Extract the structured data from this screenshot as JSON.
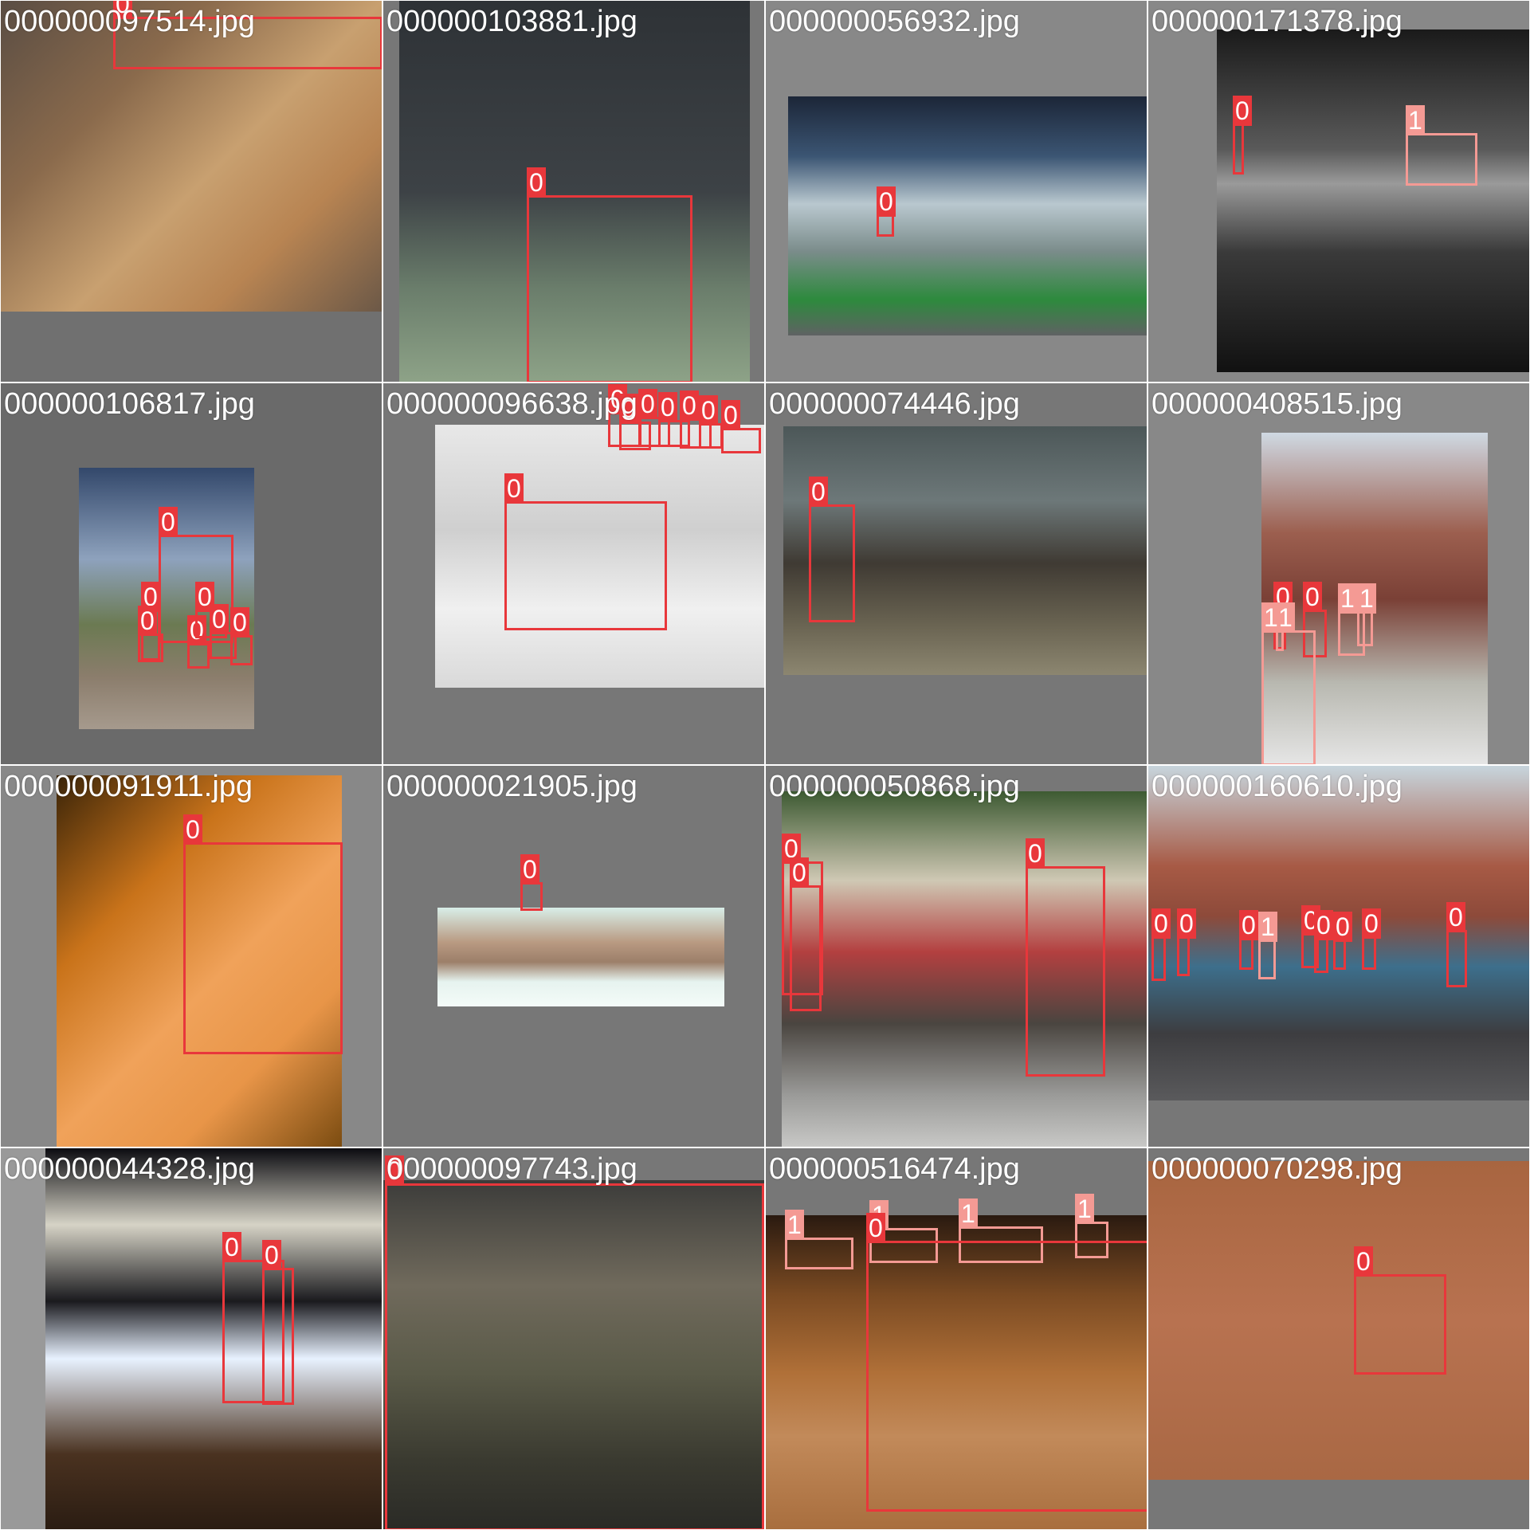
{
  "colors": {
    "class_0": "#e8373b",
    "class_1": "#f49a94",
    "padding": "#777777"
  },
  "tiles": [
    {
      "filename": "000000097514.jpg",
      "pad": "#707070",
      "photo": {
        "fill": "linear-gradient(135deg,#5a4d43 0%,#8a6a4c 30%,#c8a070 55%,#b88452 75%,#6b5847 100%)"
      },
      "boxes": [
        {
          "label": "0",
          "cls": 0
        }
      ]
    },
    {
      "filename": "000000103881.jpg",
      "pad": "#777777",
      "photo": {
        "fill": "linear-gradient(180deg,#2e3236 0%,#3d4246 50%,#6a7d6b 75%,#8ea388 100%)"
      },
      "boxes": [
        {
          "label": "0",
          "cls": 0
        }
      ]
    },
    {
      "filename": "000000056932.jpg",
      "pad": "#888888",
      "photo": {
        "fill": "linear-gradient(180deg,#1c2638 0%,#3b5573 25%,#b9c8cf 45%,#7a8c8a 65%,#2d8a3d 85%,#5f6263 100%)"
      },
      "boxes": [
        {
          "label": "0",
          "cls": 0
        }
      ]
    },
    {
      "filename": "000000171378.jpg",
      "pad": "#888888",
      "photo": {
        "fill": "linear-gradient(180deg,#1a1a1a 0%,#5a5a5a 35%,#9a9a9a 45%,#3a3a3a 65%,#111111 100%)"
      },
      "boxes": [
        {
          "label": "0",
          "cls": 0
        },
        {
          "label": "1",
          "cls": 1
        }
      ]
    },
    {
      "filename": "000000106817.jpg",
      "pad": "#6a6a6a",
      "photo": {
        "fill": "linear-gradient(180deg,#33486b 0%,#8ea2bd 35%,#6b7a52 60%,#8b7d6c 80%,#a69a8d 100%)"
      },
      "boxes": [
        {
          "label": "0",
          "cls": 0
        },
        {
          "label": "0",
          "cls": 0
        },
        {
          "label": "0",
          "cls": 0
        },
        {
          "label": "0",
          "cls": 0
        },
        {
          "label": "0",
          "cls": 0
        },
        {
          "label": "0",
          "cls": 0
        },
        {
          "label": "0",
          "cls": 0
        }
      ]
    },
    {
      "filename": "000000096638.jpg",
      "pad": "#777777",
      "photo": {
        "fill": "linear-gradient(180deg,#e8e8e8 0%,#cfcfcf 40%,#f0f0f0 70%,#d9d9d9 100%)"
      },
      "boxes": [
        {
          "label": "0",
          "cls": 0
        },
        {
          "label": "0",
          "cls": 0
        },
        {
          "label": "0",
          "cls": 0
        },
        {
          "label": "0",
          "cls": 0
        },
        {
          "label": "0",
          "cls": 0
        },
        {
          "label": "0",
          "cls": 0
        },
        {
          "label": "0",
          "cls": 0
        },
        {
          "label": "0",
          "cls": 0
        }
      ]
    },
    {
      "filename": "000000074446.jpg",
      "pad": "#777777",
      "photo": {
        "fill": "linear-gradient(180deg,#4c5758 0%,#6d7879 30%,#3f3a33 55%,#6a6452 80%,#8c8670 100%)"
      },
      "boxes": [
        {
          "label": "0",
          "cls": 0
        }
      ]
    },
    {
      "filename": "000000408515.jpg",
      "pad": "#888888",
      "photo": {
        "fill": "linear-gradient(180deg,#cfd9e3 0%,#9c5f4f 30%,#7a4036 50%,#b8b8b0 75%,#e6e6e6 100%)"
      },
      "boxes": [
        {
          "label": "0",
          "cls": 0
        },
        {
          "label": "0",
          "cls": 0
        },
        {
          "label": "1",
          "cls": 1
        },
        {
          "label": "1",
          "cls": 1
        },
        {
          "label": "1",
          "cls": 1
        },
        {
          "label": "1",
          "cls": 1
        }
      ]
    },
    {
      "filename": "000000091911.jpg",
      "pad": "#888888",
      "photo": {
        "fill": "linear-gradient(135deg,#3a2408 0%,#c9731a 30%,#f0a25a 55%,#e89548 75%,#7a4b10 100%)"
      },
      "boxes": [
        {
          "label": "0",
          "cls": 0
        }
      ]
    },
    {
      "filename": "000000021905.jpg",
      "pad": "#777777",
      "photo": {
        "fill": "linear-gradient(180deg,#d8eee8 0%,#b99a82 35%,#9c7f69 55%,#e6f3ef 75%,#f4fbf8 100%)"
      },
      "boxes": [
        {
          "label": "0",
          "cls": 0
        }
      ]
    },
    {
      "filename": "000000050868.jpg",
      "pad": "#777777",
      "photo": {
        "fill": "linear-gradient(180deg,#3d5a32 0%,#cfc8b4 25%,#b34040 45%,#4a4540 65%,#9a9a98 85%,#c9c9c7 100%)"
      },
      "boxes": [
        {
          "label": "0",
          "cls": 0
        },
        {
          "label": "0",
          "cls": 0
        },
        {
          "label": "0",
          "cls": 0
        }
      ]
    },
    {
      "filename": "000000160610.jpg",
      "pad": "#777777",
      "photo": {
        "fill": "linear-gradient(180deg,#c7d5dd 0%,#a75a45 30%,#8d4a3a 45%,#3d6f8c 60%,#3d3d40 80%,#5a5a5c 100%)"
      },
      "boxes": [
        {
          "label": "0",
          "cls": 0
        },
        {
          "label": "0",
          "cls": 0
        },
        {
          "label": "0",
          "cls": 0
        },
        {
          "label": "1",
          "cls": 1
        },
        {
          "label": "0",
          "cls": 0
        },
        {
          "label": "0",
          "cls": 0
        },
        {
          "label": "0",
          "cls": 0
        },
        {
          "label": "0",
          "cls": 0
        },
        {
          "label": "0",
          "cls": 0
        }
      ]
    },
    {
      "filename": "000000044328.jpg",
      "pad": "#999999",
      "photo": {
        "fill": "linear-gradient(180deg,#0b0b10 0%,#d6d3c6 20%,#1a1a1e 40%,#e8f2ff 55%,#4a3220 80%,#2a1c12 100%)"
      },
      "boxes": [
        {
          "label": "0",
          "cls": 0
        },
        {
          "label": "0",
          "cls": 0
        }
      ]
    },
    {
      "filename": "000000097743.jpg",
      "pad": "#777777",
      "photo": {
        "fill": "linear-gradient(180deg,#3c3c3a 0%,#706a5c 30%,#5a5a48 55%,#3a3a30 80%,#2a2a26 100%)"
      },
      "boxes": [
        {
          "label": "0",
          "cls": 0
        }
      ]
    },
    {
      "filename": "000000516474.jpg",
      "pad": "#777777",
      "photo": {
        "fill": "linear-gradient(180deg,#2a1a10 0%,#7a4a22 25%,#b07038 50%,#c28a5a 70%,#a86e3e 100%)"
      },
      "boxes": [
        {
          "label": "1",
          "cls": 1
        },
        {
          "label": "1",
          "cls": 1
        },
        {
          "label": "0",
          "cls": 0
        },
        {
          "label": "1",
          "cls": 1
        },
        {
          "label": "1",
          "cls": 1
        },
        {
          "label": "0",
          "cls": 0
        }
      ]
    },
    {
      "filename": "000000070298.jpg",
      "pad": "#777777",
      "photo": {
        "fill": "linear-gradient(180deg,#a86540 0%,#b87250 50%,#a96844 100%)"
      },
      "boxes": [
        {
          "label": "0",
          "cls": 0
        }
      ]
    }
  ]
}
